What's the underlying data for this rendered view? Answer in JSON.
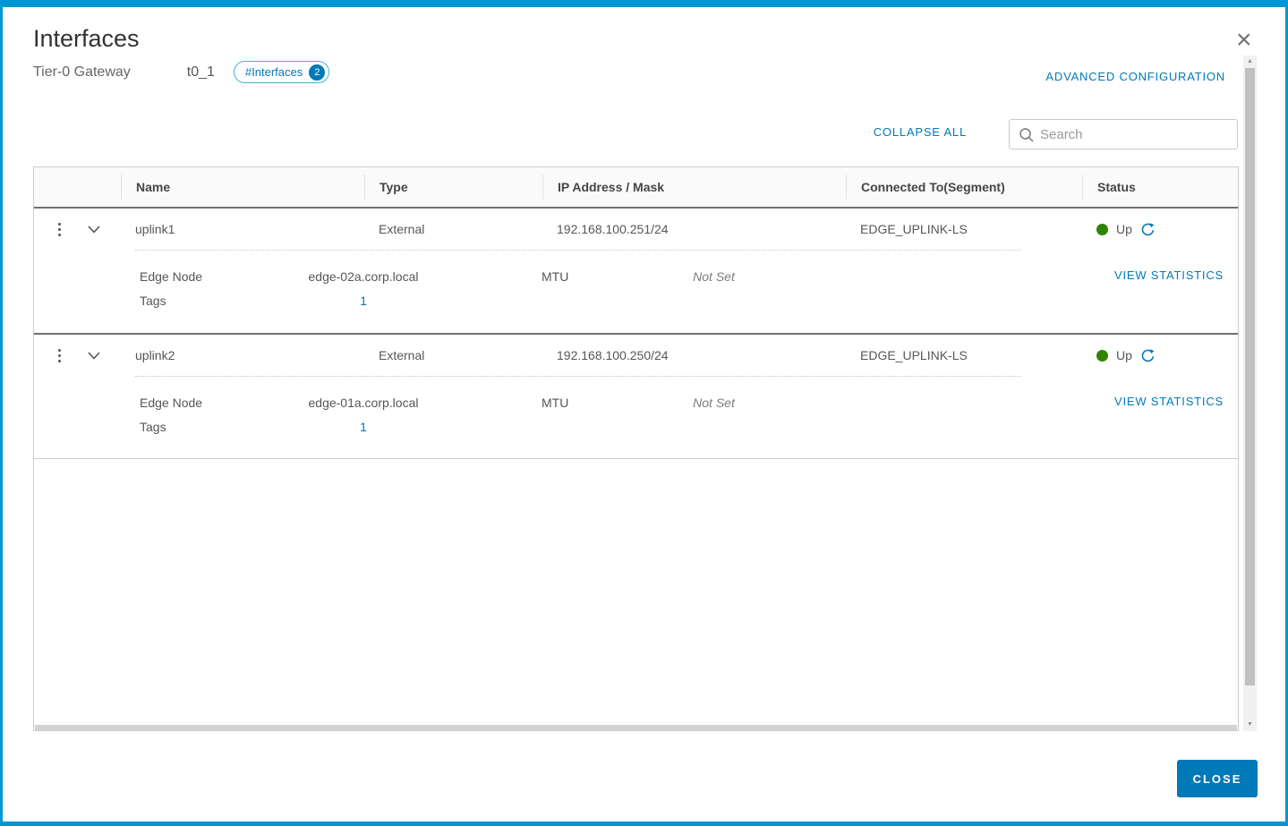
{
  "dialog": {
    "title": "Interfaces",
    "subtitle_label": "Tier-0 Gateway",
    "gateway_name": "t0_1",
    "interfaces_pill_label": "#Interfaces",
    "interfaces_count": "2",
    "advanced_link": "ADVANCED CONFIGURATION",
    "collapse_all_link": "COLLAPSE ALL",
    "search_placeholder": "Search",
    "close_button": "CLOSE"
  },
  "icons": {
    "close_glyph": "×",
    "scroll_up_glyph": "▲",
    "scroll_down_glyph": "▼"
  },
  "table": {
    "columns": {
      "name": "Name",
      "type": "Type",
      "ip": "IP Address / Mask",
      "segment": "Connected To(Segment)",
      "status": "Status"
    },
    "detail_labels": {
      "edge_node": "Edge Node",
      "mtu": "MTU",
      "tags": "Tags"
    },
    "view_statistics_label": "VIEW STATISTICS",
    "rows": [
      {
        "name": "uplink1",
        "type": "External",
        "ip": "192.168.100.251/24",
        "segment": "EDGE_UPLINK-LS",
        "status": "Up",
        "edge_node": "edge-02a.corp.local",
        "mtu": "Not Set",
        "tags": "1"
      },
      {
        "name": "uplink2",
        "type": "External",
        "ip": "192.168.100.250/24",
        "segment": "EDGE_UPLINK-LS",
        "status": "Up",
        "edge_node": "edge-01a.corp.local",
        "mtu": "Not Set",
        "tags": "1"
      }
    ]
  },
  "colors": {
    "accent_blue": "#0079b8",
    "status_up_green": "#2f8400",
    "dialog_border_blue": "#0095d3"
  }
}
